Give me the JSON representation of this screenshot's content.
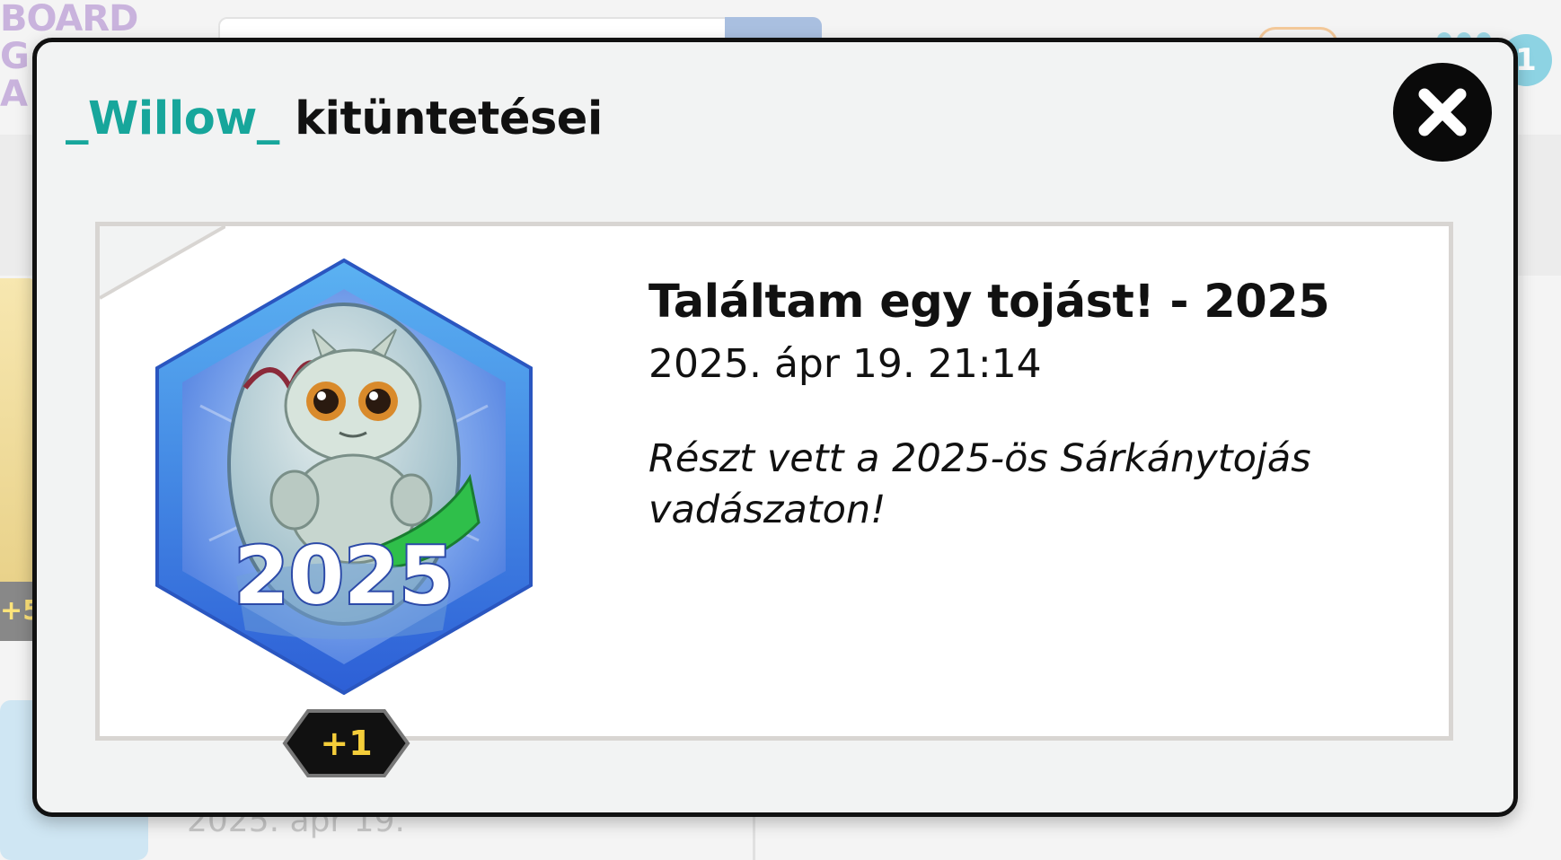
{
  "background": {
    "logo_lines": [
      "BOARD",
      "G",
      "A"
    ],
    "notification_count": "1",
    "side_badge": "+5",
    "peek_date": "2025. ápr 19."
  },
  "modal": {
    "username": "_Willow_",
    "title_suffix": " kitüntetései",
    "close_icon": "close-icon",
    "award": {
      "badge_year": "2025",
      "new_count": "+1",
      "title": "Találtam egy tojást! - 2025",
      "date": "2025. ápr 19. 21:14",
      "description": "Részt vett a 2025-ös Sárkánytojás vadászaton!"
    }
  },
  "colors": {
    "username": "#17a69b",
    "badge_blue": "#3f86e6",
    "new_tag_text": "#f4cd3a"
  }
}
